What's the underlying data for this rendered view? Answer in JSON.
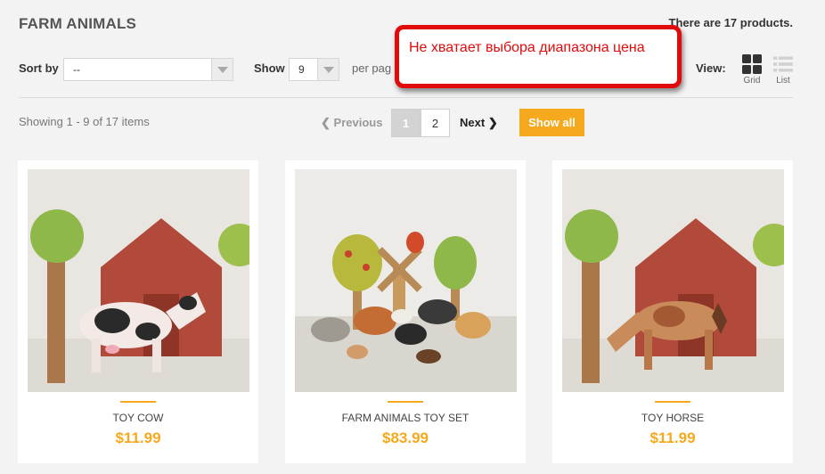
{
  "header": {
    "title": "FARM ANIMALS",
    "product_count": "There are 17 products."
  },
  "toolbar": {
    "sort_label": "Sort by",
    "sort_value": "--",
    "show_label": "Show",
    "show_value": "9",
    "per_page_label": "per pag",
    "view_label": "View:",
    "grid_label": "Grid",
    "list_label": "List"
  },
  "pagination": {
    "showing_text": "Showing 1 - 9 of 17 items",
    "previous_label": "Previous",
    "pages": [
      "1",
      "2"
    ],
    "current_page": "1",
    "next_label": "Next",
    "show_all_label": "Show all"
  },
  "annotation": {
    "text": "Не хватает выбора диапазона цена"
  },
  "products": [
    {
      "name": "TOY COW",
      "price": "$11.99",
      "image": "toy-cow-photo"
    },
    {
      "name": "FARM ANIMALS TOY SET",
      "price": "$83.99",
      "image": "farm-animals-set-photo"
    },
    {
      "name": "TOY HORSE",
      "price": "$11.99",
      "image": "toy-horse-photo"
    }
  ],
  "colors": {
    "accent": "#f6a91d",
    "callout_red": "#e10b0b",
    "page_background": "#f3f3f3"
  },
  "icons": {
    "previous": "chevron-left-icon",
    "next": "chevron-right-icon",
    "grid": "grid-view-icon",
    "list": "list-view-icon",
    "dropdown": "caret-down-icon"
  }
}
